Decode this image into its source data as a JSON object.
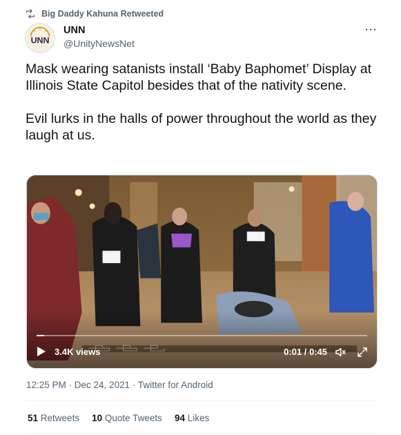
{
  "retweet": {
    "label": "Big Daddy Kahuna Retweeted",
    "icon": "retweet-icon"
  },
  "author": {
    "name": "UNN",
    "handle": "@UnityNewsNet",
    "avatar_text": "UNN",
    "avatar_icon": "unn-logo-icon"
  },
  "more_icon": "more-options-icon",
  "more_label": "···",
  "tweet": {
    "paragraph_1": "Mask wearing satanists install ‘Baby Baphomet’ Display at Illinois State Capitol besides that of the nativity scene.",
    "paragraph_2": "Evil lurks in the halls of power throughout the world as they laugh at us."
  },
  "video": {
    "views": "3.4K views",
    "time": "0:01 / 0:45",
    "progress": 0.022,
    "icons": [
      "play-icon",
      "volume-icon",
      "fullscreen-icon"
    ]
  },
  "meta": {
    "timestamp": "12:25 PM · Dec 24, 2021 · Twitter for Android"
  },
  "stats": {
    "retweets_count": "51",
    "retweets_label": "Retweets",
    "quotes_count": "10",
    "quotes_label": "Quote Tweets",
    "likes_count": "94",
    "likes_label": "Likes"
  },
  "colors": {
    "text": "#0f1419",
    "secondary": "#536471",
    "divider": "#eff3f4"
  }
}
